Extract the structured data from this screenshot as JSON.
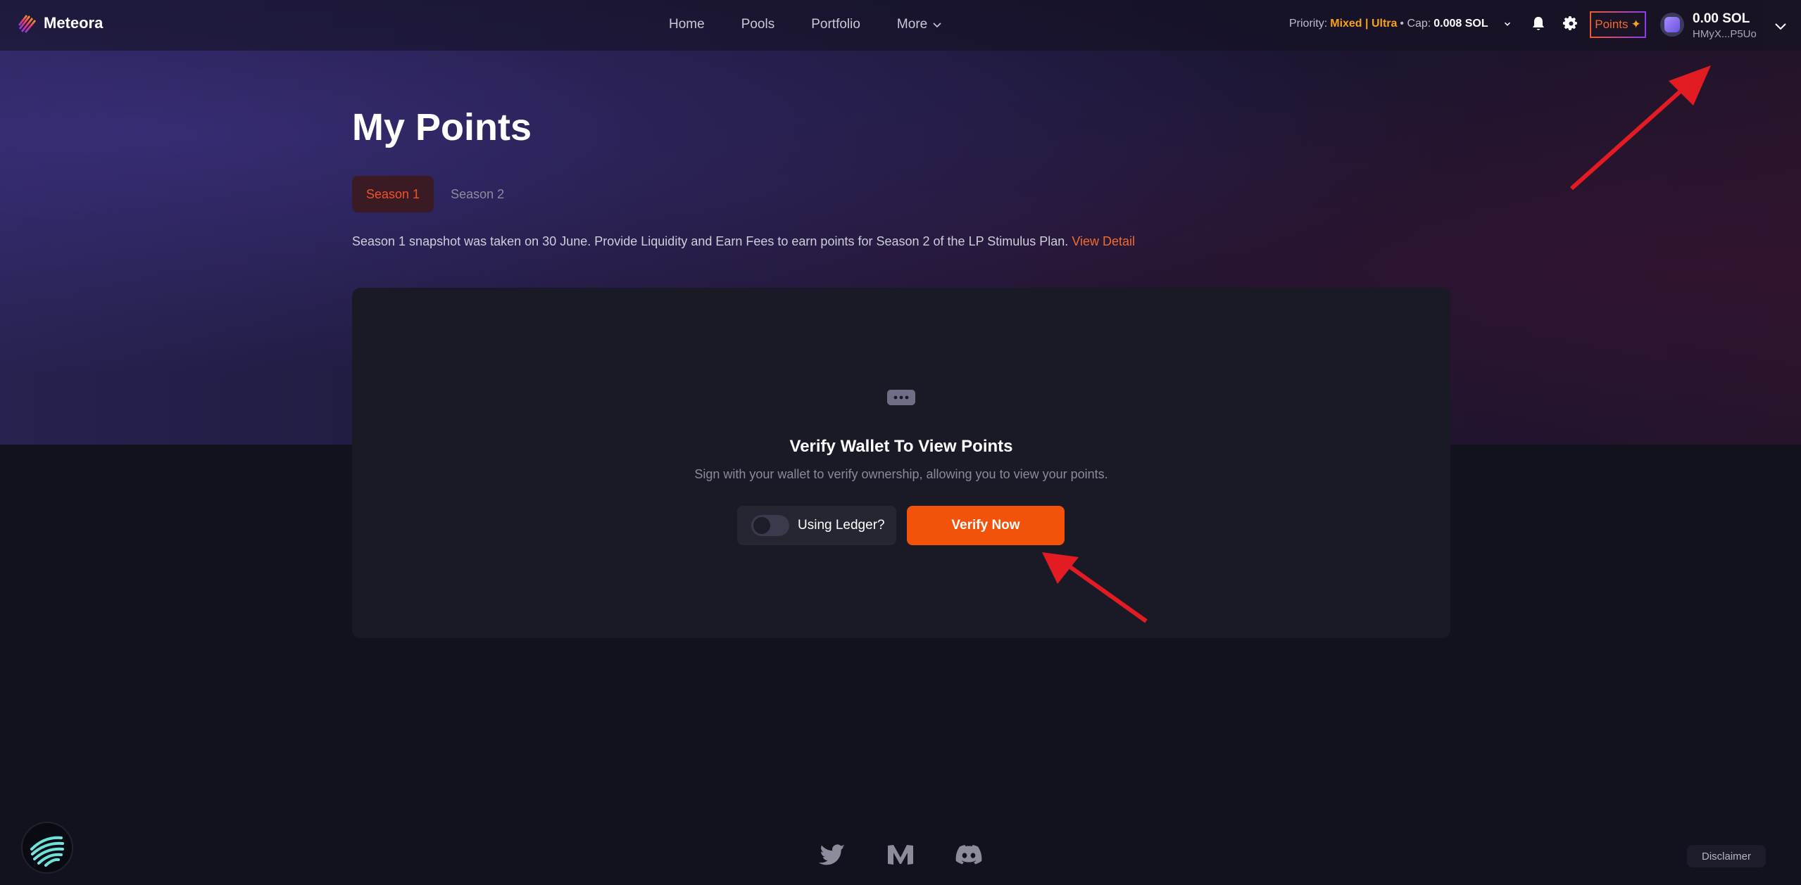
{
  "header": {
    "brand": "Meteora",
    "nav": [
      {
        "label": "Home"
      },
      {
        "label": "Pools"
      },
      {
        "label": "Portfolio"
      },
      {
        "label": "More"
      }
    ],
    "priority": {
      "label": "Priority:",
      "mode": "Mixed | Ultra",
      "cap_label": "• Cap:",
      "cap_value": "0.008 SOL"
    },
    "points_label": "Points",
    "wallet": {
      "balance": "0.00 SOL",
      "address": "HMyX...P5Uo"
    }
  },
  "main": {
    "title": "My Points",
    "tabs": [
      {
        "label": "Season 1",
        "active": true
      },
      {
        "label": "Season 2",
        "active": false
      }
    ],
    "description": "Season 1 snapshot was taken on 30 June. Provide Liquidity and Earn Fees to earn points for Season 2 of the LP Stimulus Plan.",
    "view_detail": "View Detail",
    "card": {
      "icon": "chat-bubble-dots-icon",
      "title": "Verify Wallet To View Points",
      "subtitle": "Sign with your wallet to verify ownership, allowing you to view your points.",
      "ledger_label": "Using Ledger?",
      "ledger_enabled": false,
      "verify_label": "Verify Now"
    }
  },
  "footer": {
    "social_icons": [
      "twitter-icon",
      "medium-icon",
      "discord-icon"
    ],
    "disclaimer": "Disclaimer"
  },
  "colors": {
    "accent": "#f2520a",
    "link": "#f26b2e",
    "priority": "#f7a21a",
    "annotation_arrow": "#e31b23"
  }
}
